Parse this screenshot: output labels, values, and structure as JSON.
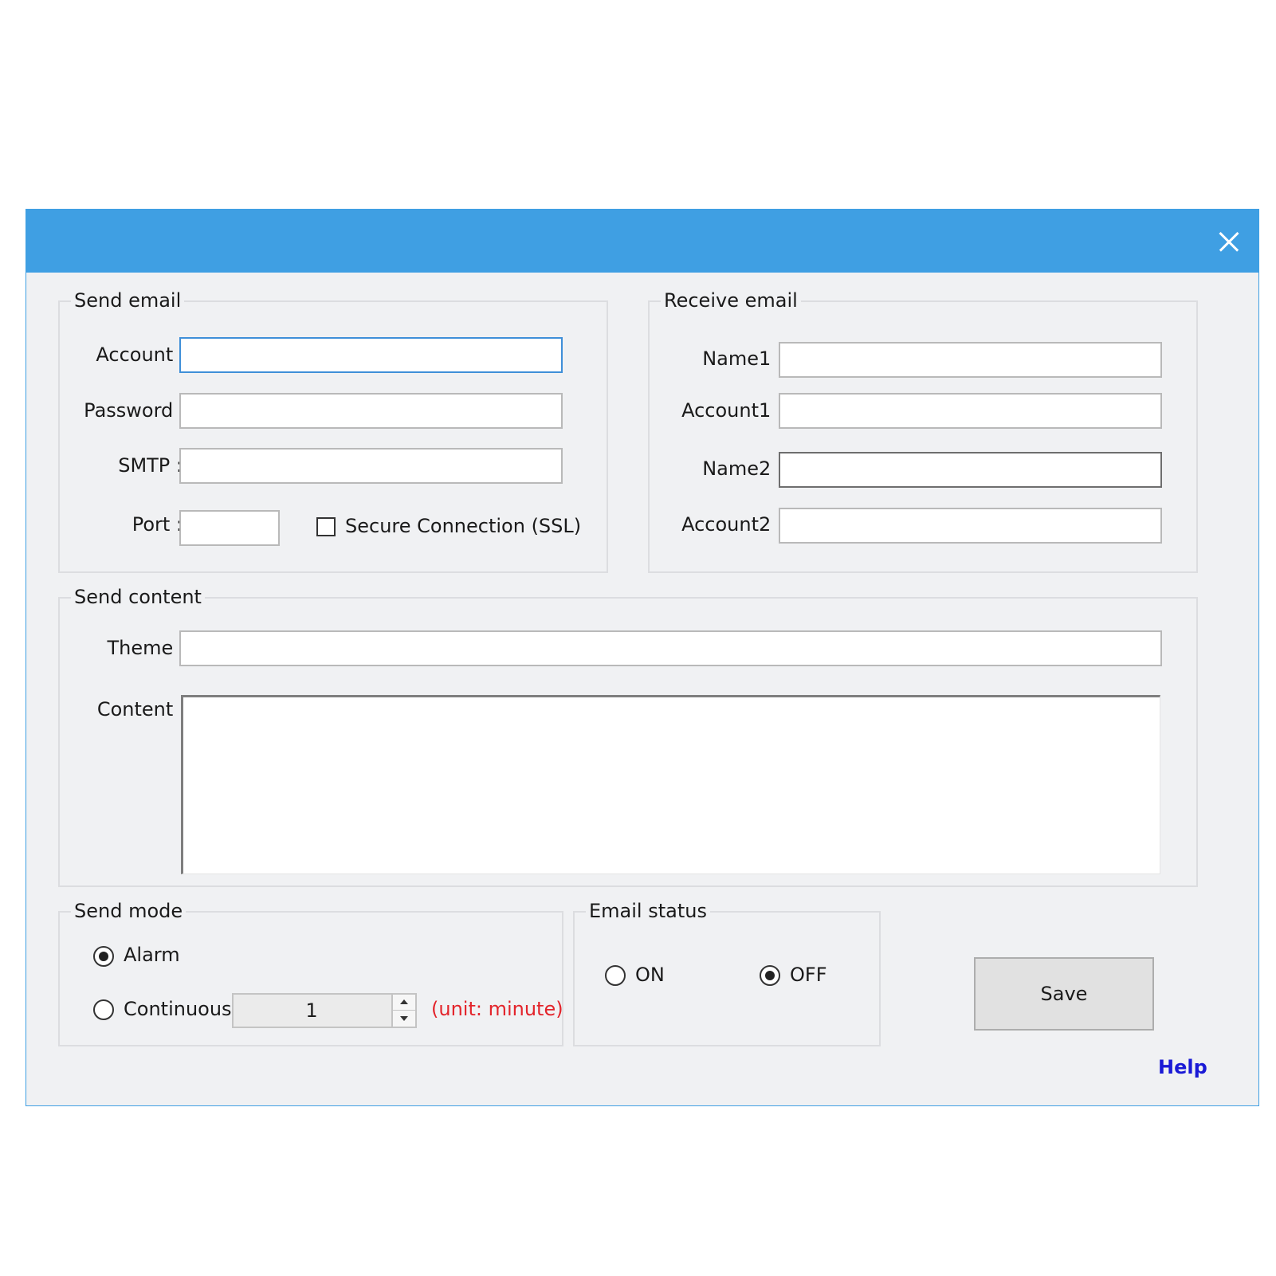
{
  "window": {
    "close_icon": "close-icon",
    "titlebar_color": "#3f9fe3"
  },
  "send_email": {
    "legend": "Send email",
    "account_label": "Account :",
    "account_value": "",
    "password_label": "Password :",
    "password_value": "",
    "smtp_label": "SMTP :",
    "smtp_value": "",
    "port_label": "Port :",
    "port_value": "",
    "ssl_label": "Secure Connection  (SSL)",
    "ssl_checked": false
  },
  "receive_email": {
    "legend": "Receive email",
    "name1_label": "Name1 :",
    "name1_value": "",
    "account1_label": "Account1 :",
    "account1_value": "",
    "name2_label": "Name2 :",
    "name2_value": "",
    "account2_label": "Account2 :",
    "account2_value": ""
  },
  "send_content": {
    "legend": "Send content",
    "theme_label": "Theme :",
    "theme_value": "",
    "content_label": "Content :",
    "content_value": ""
  },
  "send_mode": {
    "legend": "Send mode",
    "alarm_label": "Alarm",
    "continuous_label": "Continuous",
    "selected": "Alarm",
    "interval_value": "1",
    "unit_note": "(unit: minute)",
    "unit_note_color": "#e3242b"
  },
  "email_status": {
    "legend": "Email status",
    "on_label": "ON",
    "off_label": "OFF",
    "selected": "OFF"
  },
  "actions": {
    "save_label": "Save",
    "help_label": "Help",
    "help_color": "#1a1ad6"
  }
}
